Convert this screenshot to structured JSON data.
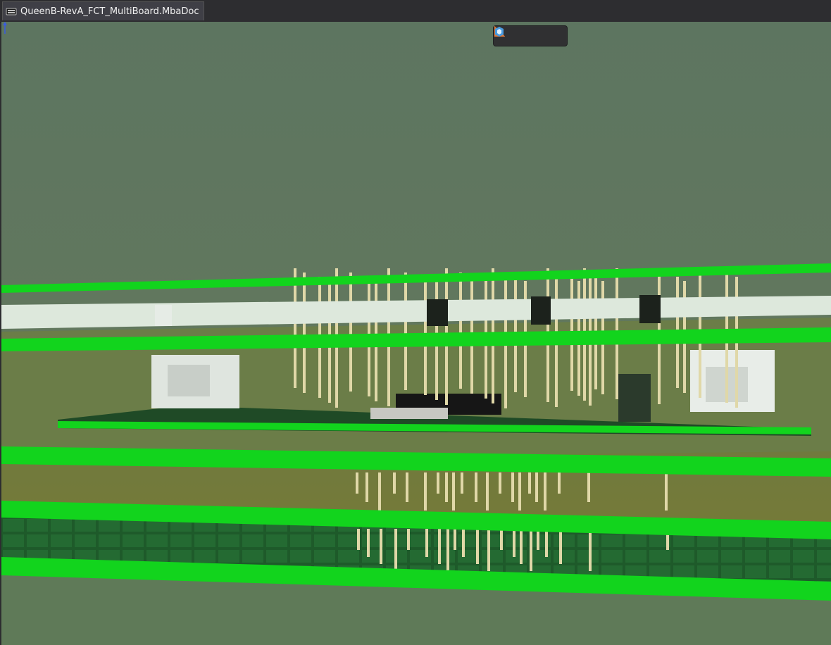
{
  "tab": {
    "title": "QueenB-RevA_FCT_MultiBoard.MbaDoc",
    "icon": "multiboard-document-icon"
  },
  "toolbar": {
    "buttons": [
      {
        "name": "layer-view-button",
        "icon": "layers-icon",
        "color": "#3fbf5f"
      },
      {
        "name": "measure-button",
        "icon": "measure-ruler-icon",
        "color": "#e07a3a"
      },
      {
        "name": "3d-view-button",
        "icon": "3d-cube-icon",
        "color": "#4a9be0"
      }
    ]
  },
  "colors": {
    "background": "#5e7660",
    "board_edge": "#12d41d",
    "pcb_green": "#1f4a26",
    "pin": "#e0d8a8",
    "floor": "#6b7a3a"
  }
}
